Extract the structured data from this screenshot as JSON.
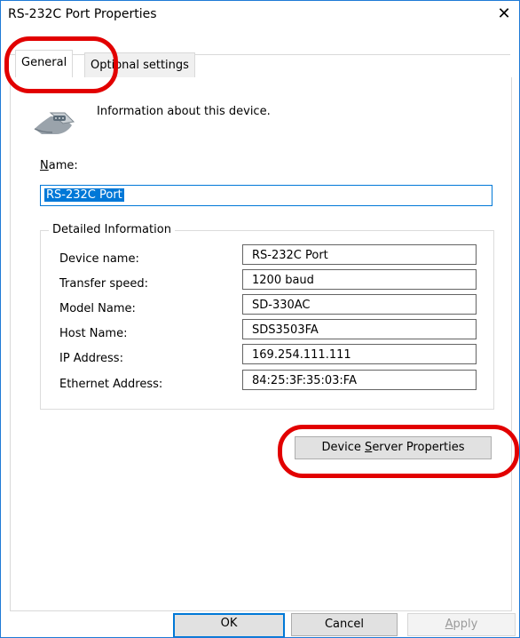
{
  "window": {
    "title": "RS-232C Port Properties",
    "close_glyph": "✕"
  },
  "tabs": [
    {
      "label": "General"
    },
    {
      "label": "Optional settings"
    }
  ],
  "general": {
    "info_text": "Information about this device.",
    "name_label": "Name:",
    "name_value": "RS-232C Port",
    "group_title": "Detailed Information",
    "rows": [
      {
        "label": "Device name:",
        "value": "RS-232C Port"
      },
      {
        "label": "Transfer speed:",
        "value": "1200 baud"
      },
      {
        "label": "Model Name:",
        "value": "SD-330AC"
      },
      {
        "label": "Host Name:",
        "value": "SDS3503FA"
      },
      {
        "label": "IP Address:",
        "value": "169.254.111.111"
      },
      {
        "label": "Ethernet Address:",
        "value": "84:25:3F:35:03:FA"
      }
    ],
    "device_server_button": "Device Server Properties"
  },
  "footer": {
    "ok": "OK",
    "cancel": "Cancel",
    "apply": "Apply"
  },
  "colors": {
    "accent": "#0078d7",
    "highlight": "#e20000",
    "window_border": "#1f7ad6"
  },
  "icons": {
    "device": "serial-port-icon",
    "close": "close-icon"
  }
}
